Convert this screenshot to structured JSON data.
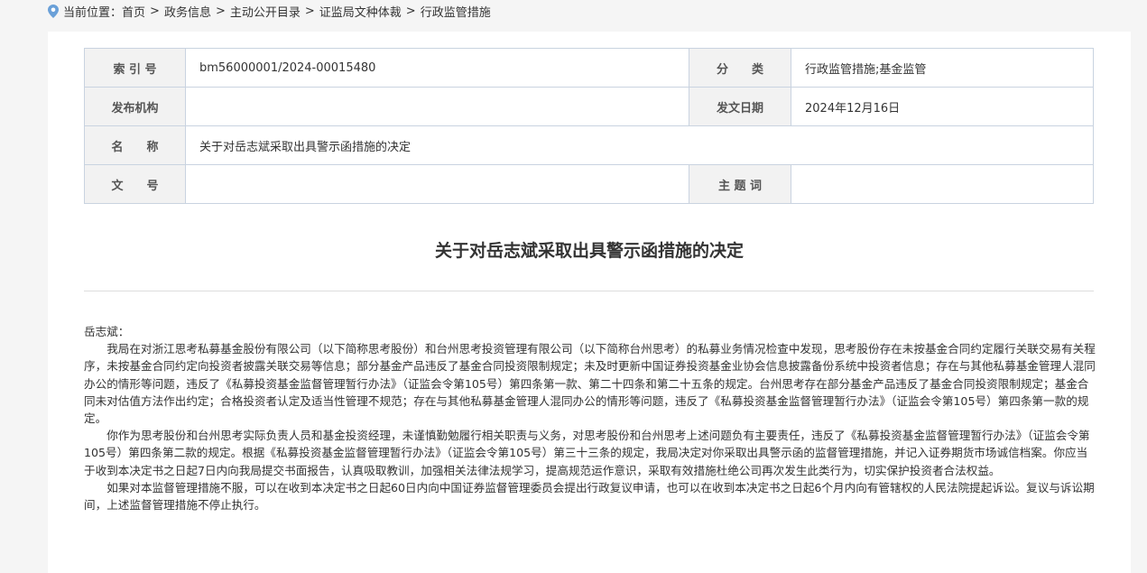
{
  "breadcrumb": {
    "prefix": "当前位置：",
    "items": [
      "首页",
      "政务信息",
      "主动公开目录",
      "证监局文种体裁",
      "行政监管措施"
    ],
    "separator": ">"
  },
  "meta": {
    "index_label": "索 引 号",
    "index_value": "bm56000001/2024-00015480",
    "category_label": "分　　类",
    "category_value": "行政监管措施;基金监管",
    "publisher_label": "发布机构",
    "publisher_value": "",
    "date_label": "发文日期",
    "date_value": "2024年12月16日",
    "name_label": "名　　称",
    "name_value": "关于对岳志斌采取出具警示函措施的决定",
    "docno_label": "文　　号",
    "docno_value": "",
    "subject_label": "主 题 词",
    "subject_value": ""
  },
  "title": "关于对岳志斌采取出具警示函措施的决定",
  "body": {
    "greeting": "岳志斌：",
    "paragraphs": [
      "我局在对浙江思考私募基金股份有限公司（以下简称思考股份）和台州思考投资管理有限公司（以下简称台州思考）的私募业务情况检查中发现，思考股份存在未按基金合同约定履行关联交易有关程序，未按基金合同约定向投资者披露关联交易等信息；部分基金产品违反了基金合同投资限制规定；未及时更新中国证券投资基金业协会信息披露备份系统中投资者信息；存在与其他私募基金管理人混同办公的情形等问题，违反了《私募投资基金监督管理暂行办法》（证监会令第105号）第四条第一款、第二十四条和第二十五条的规定。台州思考存在部分基金产品违反了基金合同投资限制规定；基金合同未对估值方法作出约定；合格投资者认定及适当性管理不规范；存在与其他私募基金管理人混同办公的情形等问题，违反了《私募投资基金监督管理暂行办法》（证监会令第105号）第四条第一款的规定。",
      "你作为思考股份和台州思考实际负责人员和基金投资经理，未谨慎勤勉履行相关职责与义务，对思考股份和台州思考上述问题负有主要责任，违反了《私募投资基金监督管理暂行办法》（证监会令第105号）第四条第二款的规定。根据《私募投资基金监督管理暂行办法》（证监会令第105号）第三十三条的规定，我局决定对你采取出具警示函的监督管理措施，并记入证券期货市场诚信档案。你应当于收到本决定书之日起7日内向我局提交书面报告，认真吸取教训，加强相关法律法规学习，提高规范运作意识，采取有效措施杜绝公司再次发生此类行为，切实保护投资者合法权益。",
      "如果对本监督管理措施不服，可以在收到本决定书之日起60日内向中国证券监督管理委员会提出行政复议申请，也可以在收到本决定书之日起6个月内向有管辖权的人民法院提起诉讼。复议与诉讼期间，上述监督管理措施不停止执行。"
    ]
  }
}
